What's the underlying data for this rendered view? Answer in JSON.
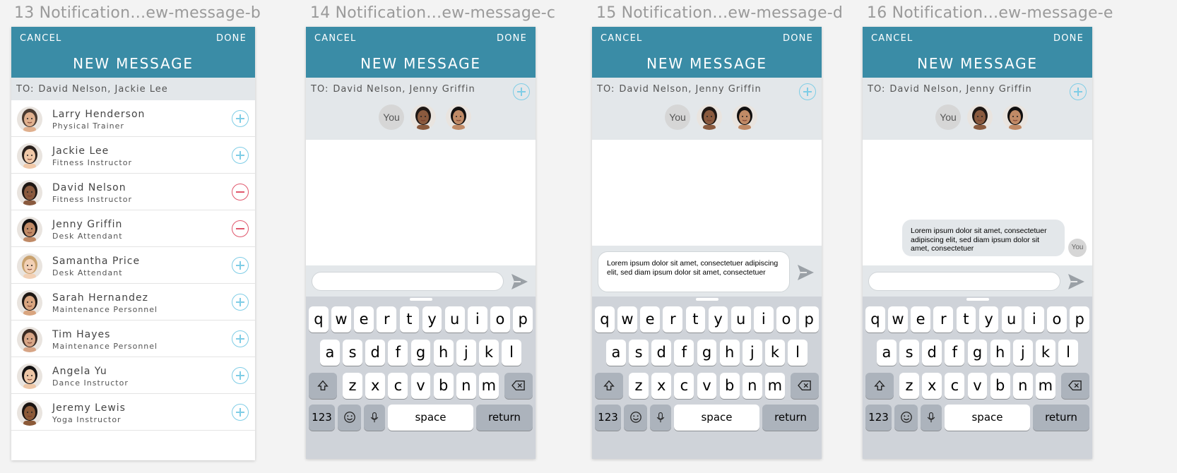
{
  "contacts": [
    {
      "name": "Larry Henderson",
      "role": "Physical Trainer",
      "selected": false,
      "skin": "#e0b08e",
      "hair": "#4a3a30"
    },
    {
      "name": "Jackie Lee",
      "role": "Fitness Instructor",
      "selected": false,
      "skin": "#f0c8a8",
      "hair": "#2a211d"
    },
    {
      "name": "David Nelson",
      "role": "Fitness Instructor",
      "selected": true,
      "skin": "#8a5a3e",
      "hair": "#1e1714"
    },
    {
      "name": "Jenny Griffin",
      "role": "Desk Attendant",
      "selected": true,
      "skin": "#c08a66",
      "hair": "#121010"
    },
    {
      "name": "Samantha Price",
      "role": "Desk Attendant",
      "selected": false,
      "skin": "#f2d0b5",
      "hair": "#c9a26f"
    },
    {
      "name": "Sarah Hernandez",
      "role": "Maintenance Personnel",
      "selected": false,
      "skin": "#d9a57f",
      "hair": "#1f1814"
    },
    {
      "name": "Tim Hayes",
      "role": "Maintenance Personnel",
      "selected": false,
      "skin": "#d7a586",
      "hair": "#3a2a22"
    },
    {
      "name": "Angela Yu",
      "role": "Dance Instructor",
      "selected": false,
      "skin": "#edc6a6",
      "hair": "#151313"
    },
    {
      "name": "Jeremy Lewis",
      "role": "Yoga Instructor",
      "selected": false,
      "skin": "#8c5a38",
      "hair": "#1a1412"
    }
  ],
  "artboards": [
    {
      "title": "13 Notification…ew-message-b",
      "cancel": "CANCEL",
      "done": "DONE",
      "heading": "NEW MESSAGE",
      "to_label": "TO:",
      "to_names": "David Nelson, Jackie Lee"
    },
    {
      "title": "14 Notification…ew-message-c",
      "cancel": "CANCEL",
      "done": "DONE",
      "heading": "NEW MESSAGE",
      "to_label": "TO:",
      "to_names": "David Nelson, Jenny Griffin",
      "you": "You"
    },
    {
      "title": "15 Notification…ew-message-d",
      "cancel": "CANCEL",
      "done": "DONE",
      "heading": "NEW MESSAGE",
      "to_label": "TO:",
      "to_names": "David Nelson, Jenny Griffin",
      "you": "You",
      "draft": "Lorem ipsum dolor sit amet, consectetuer adipiscing elit, sed diam ipsum dolor sit amet, consectetuer"
    },
    {
      "title": "16 Notification…ew-message-e",
      "cancel": "CANCEL",
      "done": "DONE",
      "heading": "NEW MESSAGE",
      "to_label": "TO:",
      "to_names": "David Nelson, Jenny Griffin",
      "you": "You",
      "sent": "Lorem ipsum dolor sit amet, consectetuer adipiscing elit, sed diam ipsum dolor sit amet, consectetuer",
      "sent_you": "You"
    }
  ],
  "keyboard": {
    "row1": [
      "q",
      "w",
      "e",
      "r",
      "t",
      "y",
      "u",
      "i",
      "o",
      "p"
    ],
    "row2": [
      "a",
      "s",
      "d",
      "f",
      "g",
      "h",
      "j",
      "k",
      "l"
    ],
    "row3": [
      "z",
      "x",
      "c",
      "v",
      "b",
      "n",
      "m"
    ],
    "numbers": "123",
    "space": "space",
    "return": "return"
  },
  "icons": {
    "shift": "shift-icon",
    "delete": "backspace-icon",
    "emoji": "emoji-icon",
    "mic": "microphone-icon",
    "send": "send-icon",
    "add": "plus-circle-icon",
    "remove": "minus-circle-icon"
  },
  "colors": {
    "header": "#3a8ca6",
    "add": "#7fcde6",
    "remove": "#e0576c",
    "keyboard": "#cfd3d9",
    "panel": "#e3e7ea"
  }
}
